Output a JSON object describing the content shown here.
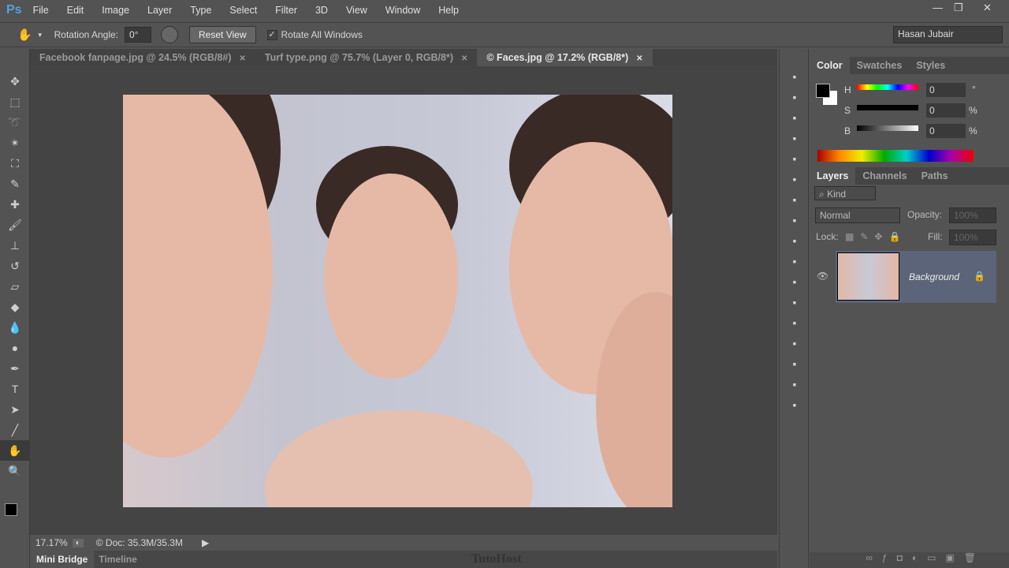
{
  "app": {
    "logo": "Ps"
  },
  "menu": [
    "File",
    "Edit",
    "Image",
    "Layer",
    "Type",
    "Select",
    "Filter",
    "3D",
    "View",
    "Window",
    "Help"
  ],
  "window_controls": {
    "minimize": "—",
    "restore": "❐",
    "close": "✕"
  },
  "options": {
    "rotation_label": "Rotation Angle:",
    "rotation_value": "0°",
    "reset_view": "Reset View",
    "rotate_all": "Rotate All Windows",
    "rotate_all_checked": true,
    "workspace": "Hasan Jubair"
  },
  "tabs": [
    {
      "label": "Facebook fanpage.jpg @ 24.5% (RGB/8#)",
      "active": false
    },
    {
      "label": "Turf type.png @ 75.7% (Layer 0, RGB/8*)",
      "active": false
    },
    {
      "label": "© Faces.jpg @ 17.2% (RGB/8*)",
      "active": true
    }
  ],
  "tools": [
    "move-icon",
    "marquee-icon",
    "lasso-icon",
    "magic-wand-icon",
    "crop-icon",
    "eyedropper-icon",
    "healing-icon",
    "brush-icon",
    "stamp-icon",
    "history-brush-icon",
    "eraser-icon",
    "bucket-icon",
    "blur-icon",
    "dodge-icon",
    "pen-icon",
    "type-icon",
    "path-select-icon",
    "line-icon",
    "rotate-view-icon",
    "zoom-icon"
  ],
  "tool_glyphs": [
    "✥",
    "⬚",
    "➰",
    "✴",
    "⛶",
    "✎",
    "✚",
    "🖌",
    "⊥",
    "↺",
    "▱",
    "◆",
    "💧",
    "●",
    "✒",
    "T",
    "➤",
    "╱",
    "✋",
    "🔍"
  ],
  "status": {
    "zoom": "17.17%",
    "doc": "© Doc: 35.3M/35.3M"
  },
  "bottom_tabs": [
    "Mini Bridge",
    "Timeline"
  ],
  "watermark": "TutoHost",
  "color_panel": {
    "tabs": [
      "Color",
      "Swatches",
      "Styles"
    ],
    "H": {
      "label": "H",
      "value": "0",
      "unit": "°"
    },
    "S": {
      "label": "S",
      "value": "0",
      "unit": "%"
    },
    "B": {
      "label": "B",
      "value": "0",
      "unit": "%"
    },
    "foreground": "#000000",
    "background": "#ffffff"
  },
  "layers_panel": {
    "tabs": [
      "Layers",
      "Channels",
      "Paths"
    ],
    "filter": "Kind",
    "blend_mode": "Normal",
    "opacity_label": "Opacity:",
    "opacity": "100%",
    "lock_label": "Lock:",
    "fill_label": "Fill:",
    "fill": "100%",
    "layers": [
      {
        "name": "Background",
        "visible": true,
        "locked": true
      }
    ]
  }
}
